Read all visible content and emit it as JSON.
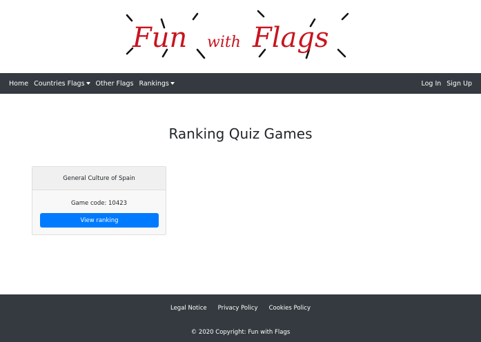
{
  "logo": {
    "line1": "Fun",
    "line2": "with",
    "line3": "Flags",
    "color": "#c8141e"
  },
  "navbar": {
    "items": [
      {
        "label": "Home",
        "dropdown": false
      },
      {
        "label": "Countries Flags",
        "dropdown": true
      },
      {
        "label": "Other Flags",
        "dropdown": false
      },
      {
        "label": "Rankings",
        "dropdown": true
      }
    ],
    "login": "Log In",
    "signup": "Sign Up",
    "background": "#343a40"
  },
  "main": {
    "title": "Ranking Quiz Games",
    "cards": [
      {
        "name": "General Culture of Spain",
        "code": "Game code: 10423",
        "button": "View ranking"
      }
    ]
  },
  "footer": {
    "links": [
      "Legal Notice",
      "Privacy Policy",
      "Cookies Policy"
    ],
    "copyright": "© 2020 Copyright: Fun with Flags"
  },
  "colors": {
    "primary": "#007bff",
    "dark": "#343a40"
  }
}
